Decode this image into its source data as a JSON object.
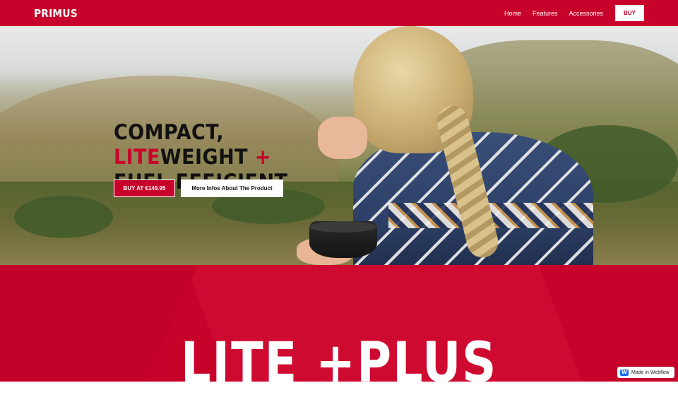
{
  "brand": {
    "name": "PRIMUS",
    "accent": "#c8032b"
  },
  "nav": {
    "links": [
      "Home",
      "Features",
      "Accessories"
    ],
    "buy_label": "BUY"
  },
  "hero": {
    "headline": {
      "line1": "COMPACT,",
      "line2_highlight": "LITE",
      "line2_rest": "WEIGHT",
      "line2_plus": "+",
      "line3": "FUEL EFFICIENT"
    },
    "buy_button": "BUY AT €149.95",
    "info_button": "More Infos About The Product"
  },
  "section": {
    "title": "LITE +PLUS"
  },
  "badge": {
    "icon": "webflow-icon",
    "glyph": "W",
    "label": "Made in Webflow"
  }
}
